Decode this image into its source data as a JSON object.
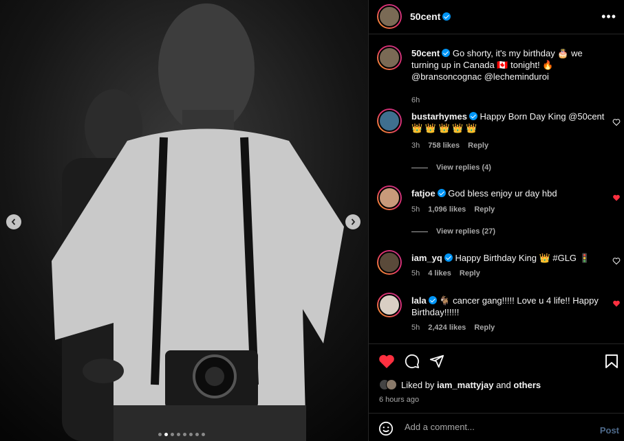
{
  "post": {
    "author": "50cent",
    "carousel": {
      "total": 8,
      "current": 2
    }
  },
  "caption": {
    "author": "50cent",
    "text_line1": "Go shorty, it's my birthday 🎂 we",
    "text_line2": "turning up in Canada 🇨🇦 tonight! 🔥",
    "text_line3": "@bransoncognac @lecheminduroi",
    "time": "6h"
  },
  "comments": [
    {
      "user": "bustarhymes",
      "text": "Happy Born Day King @50cent",
      "text2": "👑 👑 👑 👑 👑",
      "time": "3h",
      "likes": "758 likes",
      "reply": "Reply",
      "liked": false,
      "view_replies": "View replies (4)"
    },
    {
      "user": "fatjoe",
      "text": "God bless enjoy ur day hbd",
      "text2": "",
      "time": "5h",
      "likes": "1,096 likes",
      "reply": "Reply",
      "liked": true,
      "view_replies": "View replies (27)"
    },
    {
      "user": "iam_yq",
      "text": "Happy Birthday King 👑 #GLG 🚦",
      "text2": "",
      "time": "5h",
      "likes": "4 likes",
      "reply": "Reply",
      "liked": false,
      "view_replies": ""
    },
    {
      "user": "lala",
      "text": "🐐 cancer gang!!!!! Love u 4 life!! Happy",
      "text2": "Birthday!!!!!!",
      "time": "5h",
      "likes": "2,424 likes",
      "reply": "Reply",
      "liked": true,
      "view_replies": ""
    }
  ],
  "likes": {
    "prefix": "Liked by",
    "user": "iam_mattyjay",
    "and": "and",
    "others": "others",
    "time_ago": "6 hours ago"
  },
  "add_comment": {
    "placeholder": "Add a comment...",
    "post_label": "Post"
  },
  "colors": {
    "like_red": "#ff3040",
    "verified_blue": "#0095f6",
    "muted": "#a8a8a8"
  }
}
